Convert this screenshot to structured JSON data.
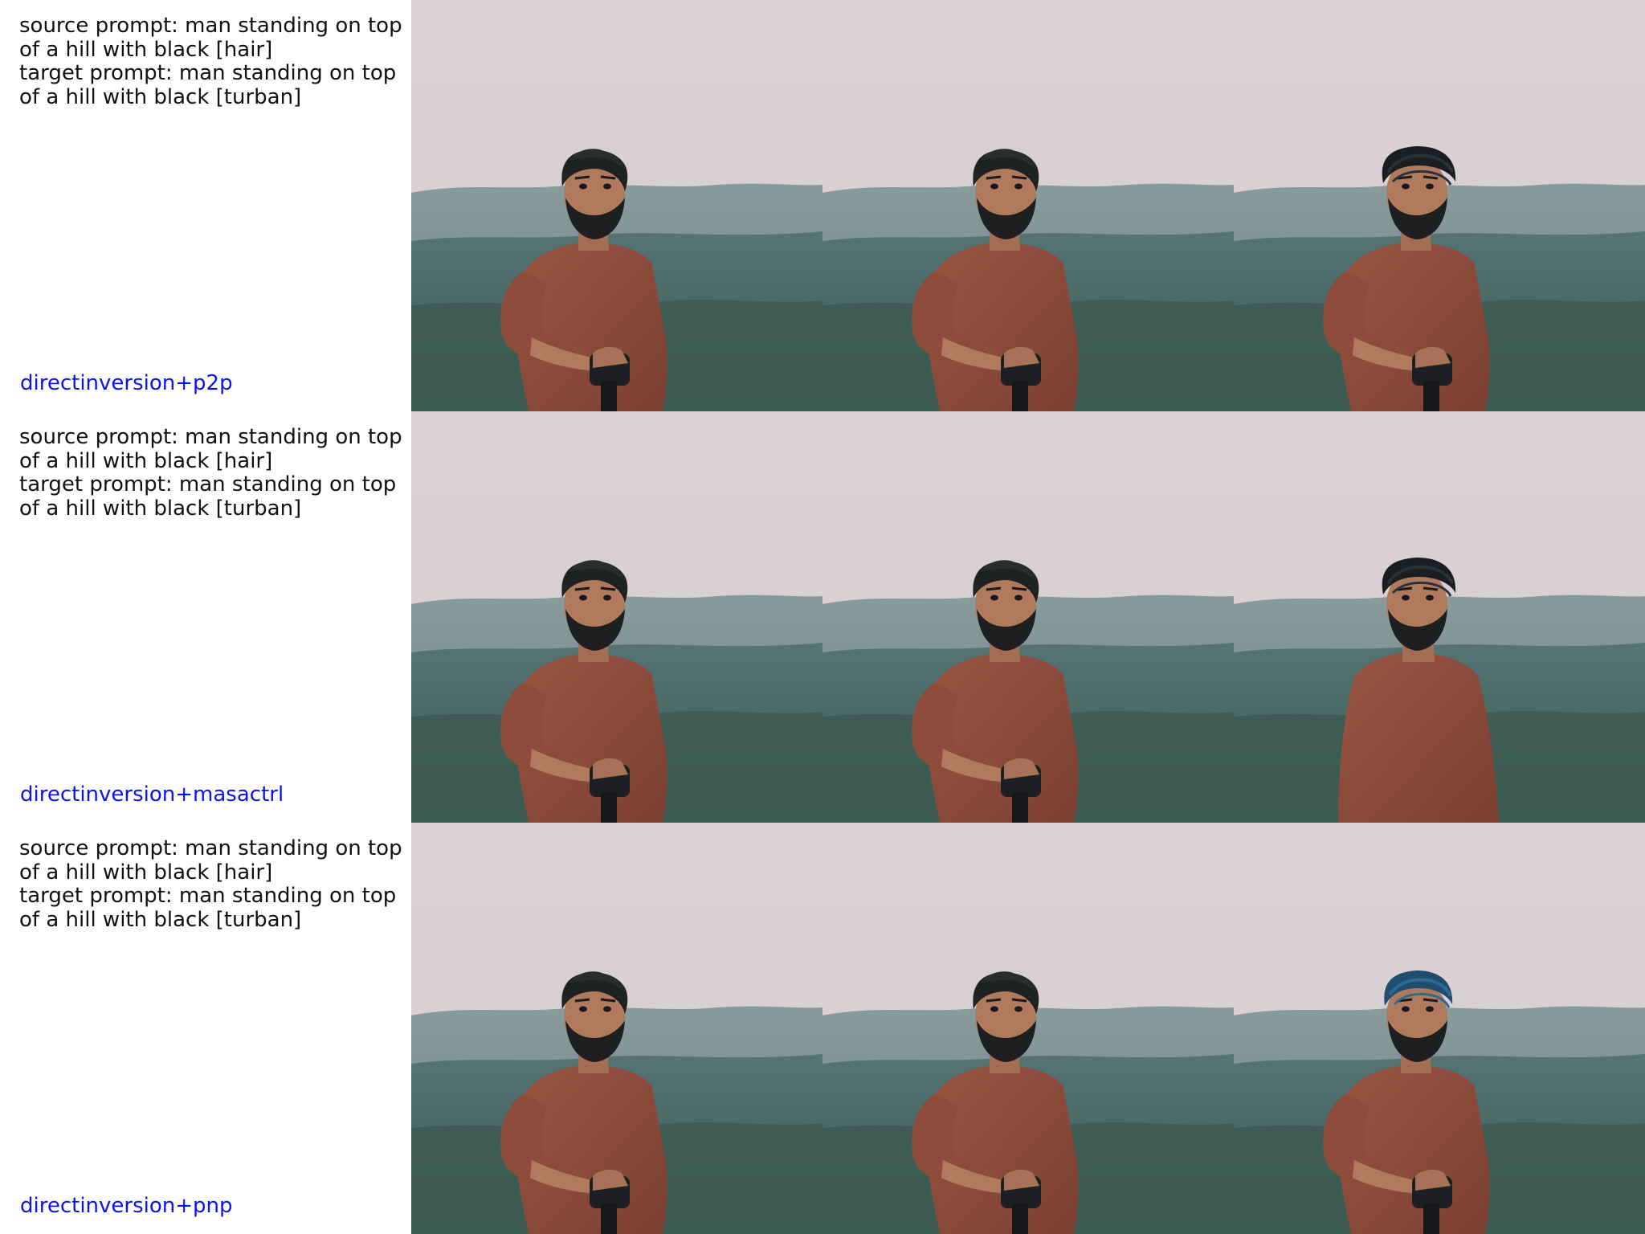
{
  "rows": [
    {
      "source_prompt": "source prompt: man standing on top of a hill with black [hair]",
      "target_prompt": "target prompt: man standing on top of a hill with black [turban]",
      "method": "directinversion+p2p"
    },
    {
      "source_prompt": "source prompt: man standing on top of a hill with black [hair]",
      "target_prompt": "target prompt: man standing on top of a hill with black [turban]",
      "method": "directinversion+masactrl"
    },
    {
      "source_prompt": "source prompt: man standing on top of a hill with black [hair]",
      "target_prompt": "target prompt: man standing on top of a hill with black [turban]",
      "method": "directinversion+pnp"
    }
  ],
  "colors": {
    "method_label": "#0b12f0",
    "sky": "#ddd3d6",
    "hills": "#5f7f82",
    "forest": "#3f5f5d",
    "shirt": "#8a4a3a",
    "skin": "#b07a5e",
    "hair": "#1f2222",
    "turban_black": "#1a1d22",
    "turban_blue": "#1f4d6e"
  }
}
